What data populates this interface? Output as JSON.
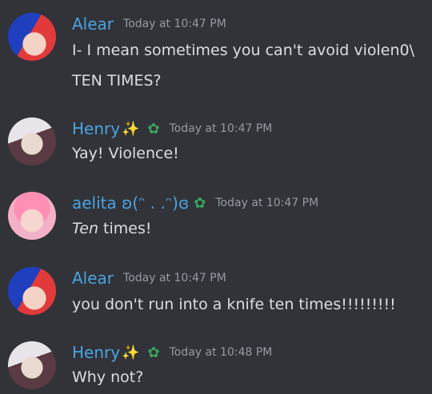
{
  "messages": [
    {
      "author": "Alear",
      "time": "Today at 10:47 PM",
      "lines": [
        "I- I mean sometimes you can't avoid violen0\\",
        "TEN TIMES?"
      ]
    },
    {
      "author": "Henry",
      "author_emoji": "✨",
      "badge_icon": "green-flower-icon",
      "time": "Today at 10:47 PM",
      "lines": [
        "Yay! Violence!"
      ]
    },
    {
      "author": "aelita ʚ(ᵔ . .ᵔ)ɞ",
      "badge_icon": "green-flower-icon",
      "time": "Today at 10:47 PM",
      "text_italic": "Ten",
      "text_rest": " times!"
    },
    {
      "author": "Alear",
      "time": "Today at 10:47 PM",
      "lines": [
        "you don't run into a knife ten times!!!!!!!!!"
      ]
    },
    {
      "author": "Henry",
      "author_emoji": "✨",
      "badge_icon": "green-flower-icon",
      "time": "Today at 10:48 PM",
      "lines": [
        "Why not?"
      ]
    }
  ],
  "colors": {
    "background": "#313338",
    "name_blue": "#4aa3df",
    "timestamp": "#949ba4",
    "text": "#dbdee1",
    "badge_green": "#3ba55d"
  }
}
